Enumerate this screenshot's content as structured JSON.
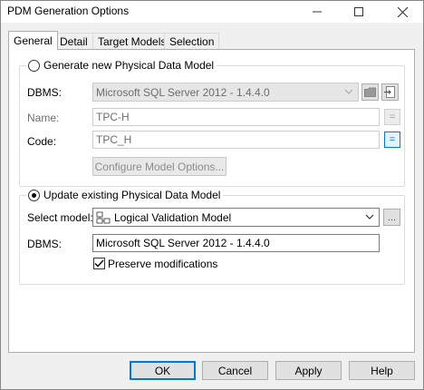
{
  "window": {
    "title": "PDM Generation Options"
  },
  "tabs": [
    {
      "label": "General",
      "active": true
    },
    {
      "label": "Detail",
      "active": false
    },
    {
      "label": "Target Models",
      "active": false
    },
    {
      "label": "Selection",
      "active": false
    }
  ],
  "generate_new": {
    "label": "Generate new Physical Data Model",
    "selected": false,
    "dbms_label": "DBMS:",
    "dbms_value": "Microsoft SQL Server 2012 - 1.4.4.0",
    "name_label": "Name:",
    "name_value": "TPC-H",
    "code_label": "Code:",
    "code_value": "TPC_H",
    "equals_glyph": "=",
    "configure_button": "Configure Model Options..."
  },
  "update_existing": {
    "label": "Update existing Physical Data Model",
    "selected": true,
    "select_model_label": "Select model:",
    "select_model_value": "Logical Validation Model",
    "ellipsis": "...",
    "dbms_label": "DBMS:",
    "dbms_value": "Microsoft SQL Server 2012 - 1.4.4.0",
    "preserve_label": "Preserve modifications",
    "preserve_checked": true
  },
  "footer": {
    "ok": "OK",
    "cancel": "Cancel",
    "apply": "Apply",
    "help": "Help"
  },
  "colors": {
    "accent": "#0078d7",
    "window_bg": "#f0f0f0",
    "disabled_text": "#6d6d6d"
  }
}
